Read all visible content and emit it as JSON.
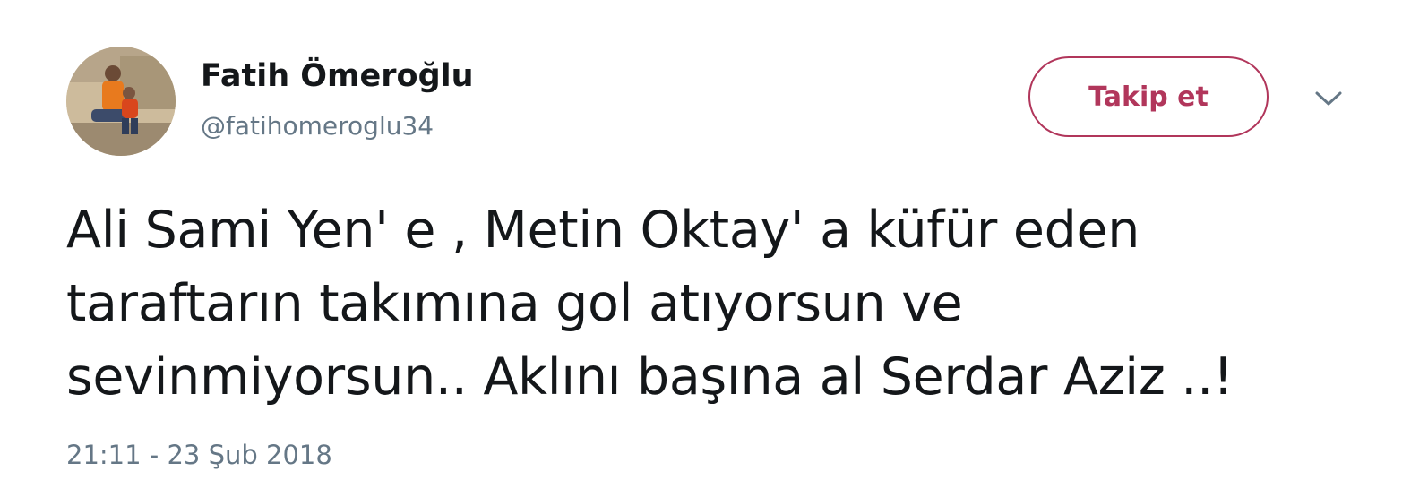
{
  "tweet": {
    "author": {
      "display_name": "Fatih Ömeroğlu",
      "handle": "@fatihomeroglu34"
    },
    "follow_label": "Takip et",
    "text_lines": [
      "Ali Sami Yen' e , Metin Oktay' a küfür eden",
      "taraftarın takımına gol atıyorsun ve",
      "sevinmiyorsun.. Aklını başına al Serdar Aziz ..!"
    ],
    "timestamp": "21:11 - 23 Şub 2018"
  },
  "icons": {
    "more_menu": "chevron-down-icon",
    "avatar": "profile-photo"
  },
  "colors": {
    "follow_accent": "#b1365b",
    "secondary_text": "#657786",
    "primary_text": "#14171a"
  }
}
